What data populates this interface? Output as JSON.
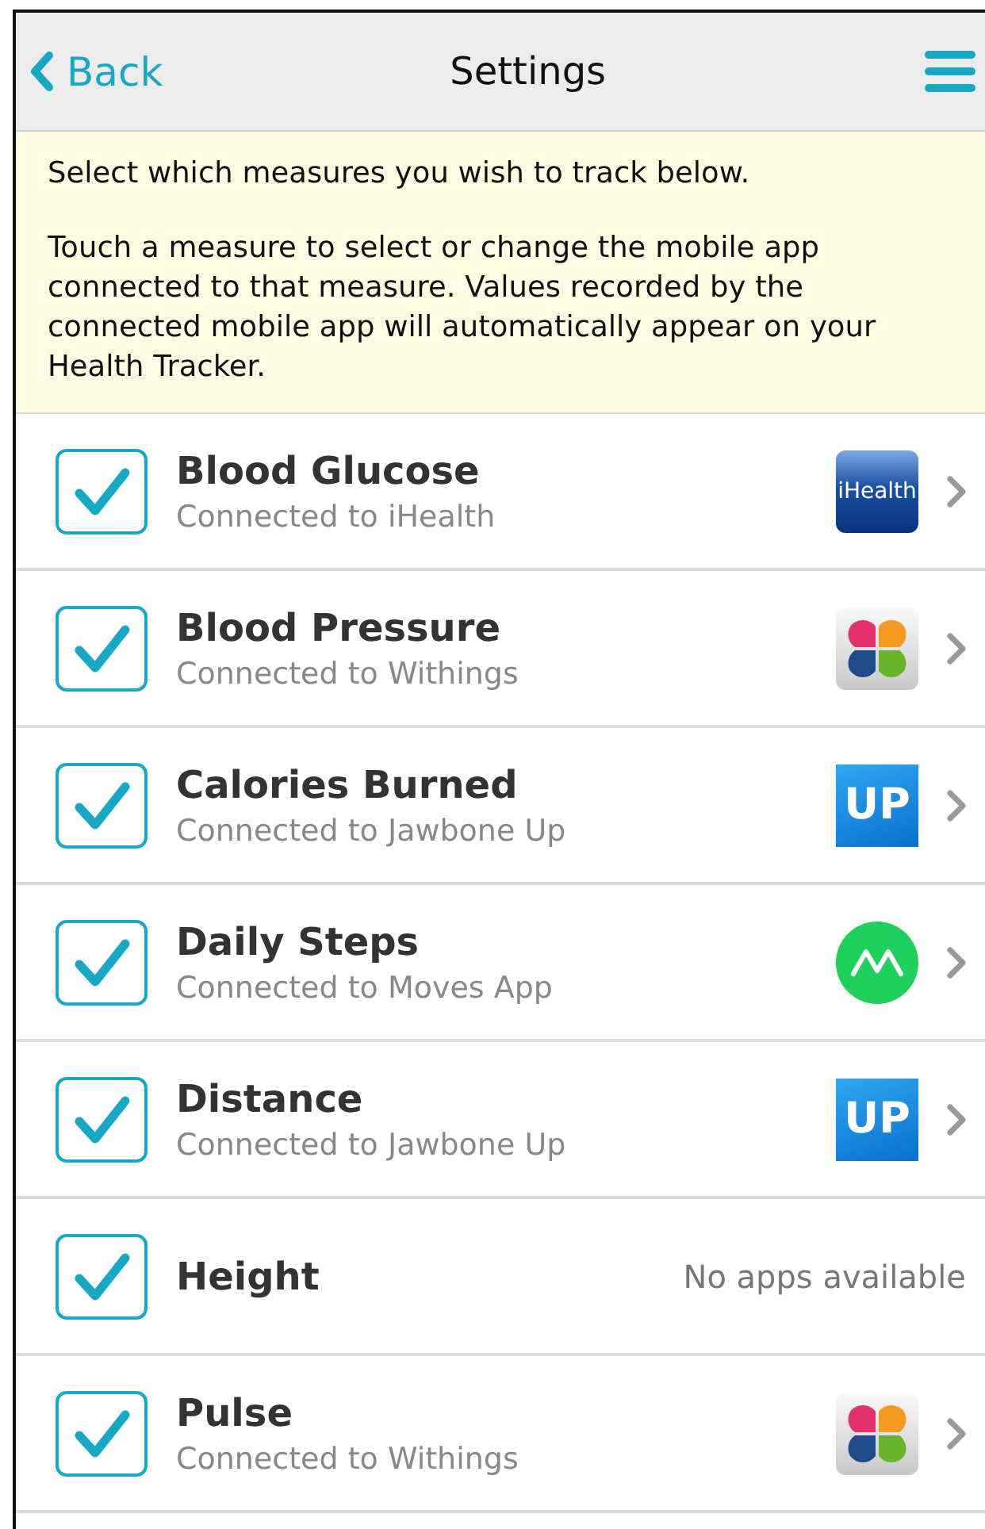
{
  "header": {
    "back": "Back",
    "title": "Settings"
  },
  "notice": [
    "Select which measures you wish to track below.",
    "Touch a measure to select or change the mobile app connected to that measure. Values recorded by the connected mobile app will automatically appear on your Health Tracker."
  ],
  "measures": [
    {
      "name": "Blood Glucose",
      "checked": true,
      "subtitle": "Connected to iHealth",
      "app": {
        "kind": "ihealth",
        "logo_text": "iHealth"
      }
    },
    {
      "name": "Blood Pressure",
      "checked": true,
      "subtitle": "Connected to Withings",
      "app": {
        "kind": "clover"
      }
    },
    {
      "name": "Calories Burned",
      "checked": true,
      "subtitle": "Connected to Jawbone Up",
      "app": {
        "kind": "up",
        "logo_text": "UP"
      }
    },
    {
      "name": "Daily Steps",
      "checked": true,
      "subtitle": "Connected to Moves App",
      "app": {
        "kind": "moves"
      }
    },
    {
      "name": "Distance",
      "checked": true,
      "subtitle": "Connected to Jawbone Up",
      "app": {
        "kind": "up",
        "logo_text": "UP"
      }
    },
    {
      "name": "Height",
      "checked": true,
      "note": "No apps available"
    },
    {
      "name": "Pulse",
      "checked": true,
      "subtitle": "Connected to Withings",
      "app": {
        "kind": "clover"
      }
    }
  ]
}
